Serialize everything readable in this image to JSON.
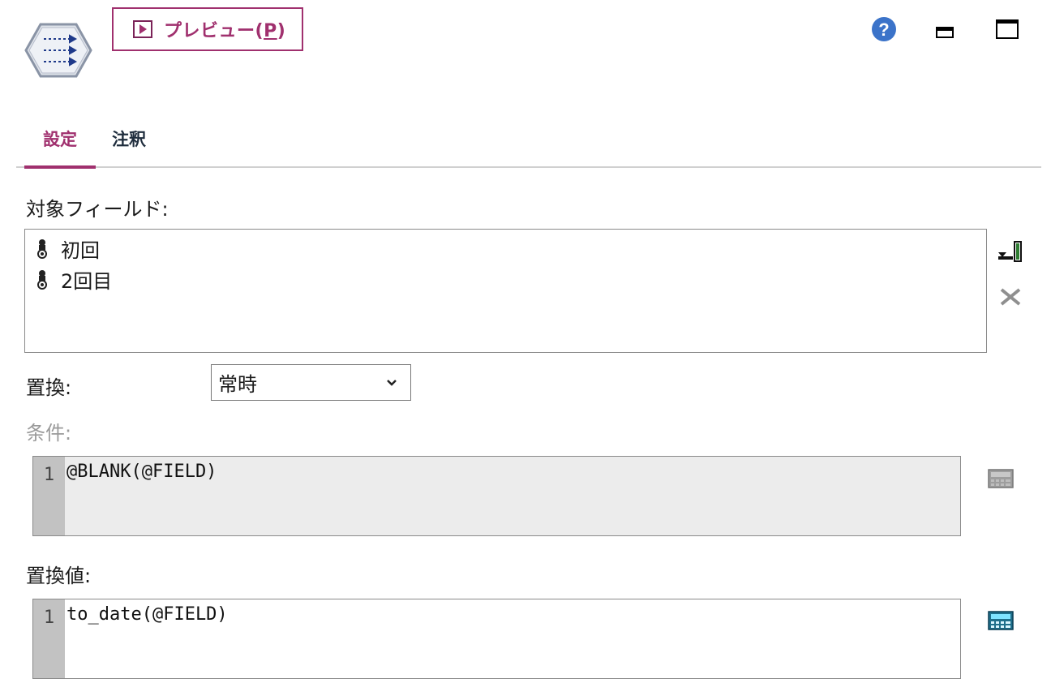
{
  "toolbar": {
    "preview_label": "プレビュー(",
    "preview_mnemonic": "P",
    "preview_close": ")"
  },
  "window_controls": {
    "help_icon": "question-circle-icon",
    "minimize_icon": "minimize-icon",
    "maximize_icon": "maximize-icon"
  },
  "tabs": [
    {
      "label": "設定",
      "active": true
    },
    {
      "label": "注釈",
      "active": false
    }
  ],
  "form": {
    "target_fields_label": "対象フィールド:",
    "target_fields": [
      {
        "name": "初回",
        "icon": "continuous-field-icon"
      },
      {
        "name": "2回目",
        "icon": "continuous-field-icon"
      }
    ],
    "replace_label": "置換:",
    "replace_value": "常時",
    "condition_label": "条件:",
    "condition": {
      "line_number": "1",
      "code": "@BLANK(@FIELD)",
      "enabled": false
    },
    "replace_value_label": "置換値:",
    "replacement": {
      "line_number": "1",
      "code": "to_date(@FIELD)",
      "enabled": true
    }
  },
  "colors": {
    "accent": "#a0306e",
    "tab_inactive": "#1f2d3d",
    "disabled_text": "#9a9a9a",
    "gutter": "#c2c2c2",
    "disabled_editor_bg": "#ececec"
  }
}
